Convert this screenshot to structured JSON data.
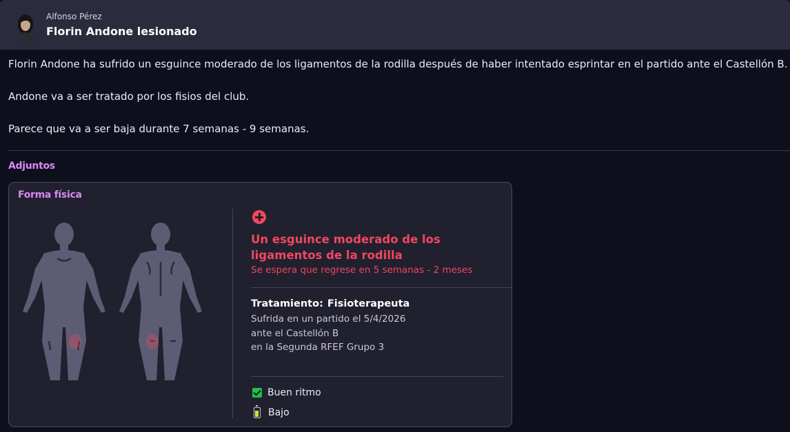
{
  "message": {
    "sender": "Alfonso Pérez",
    "subject": "Florin Andone lesionado",
    "paragraphs": [
      "Florin Andone ha sufrido un esguince moderado de los ligamentos de la rodilla después de haber intentado esprintar en el partido ante el Castellón B.",
      "Andone va a ser tratado por los fisios del club.",
      "Parece que va a ser baja durante 7 semanas - 9 semanas."
    ]
  },
  "attachments": {
    "heading": "Adjuntos",
    "card": {
      "title": "Forma física",
      "injury": {
        "icon": "plus-circle-icon",
        "name": "Un esguince moderado de los ligamentos de la rodilla",
        "return_estimate": "Se espera que regrese en 5 semanas - 2 meses",
        "treatment_label": "Tratamiento:",
        "treatment_value": "Fisioterapeuta",
        "details": [
          "Sufrida en un partido el 5/4/2026",
          "ante el Castellón B",
          "en la Segunda RFEF Grupo 3"
        ]
      },
      "status": [
        {
          "icon": "check-icon",
          "label": "Buen ritmo"
        },
        {
          "icon": "battery-icon",
          "label": "Bajo"
        }
      ],
      "injury_zone": "knees"
    }
  },
  "colors": {
    "accent_purple": "#d989f2",
    "injury_red": "#f0475f",
    "ok_green": "#1fbf4e",
    "battery_yellow": "#d6df2a"
  }
}
